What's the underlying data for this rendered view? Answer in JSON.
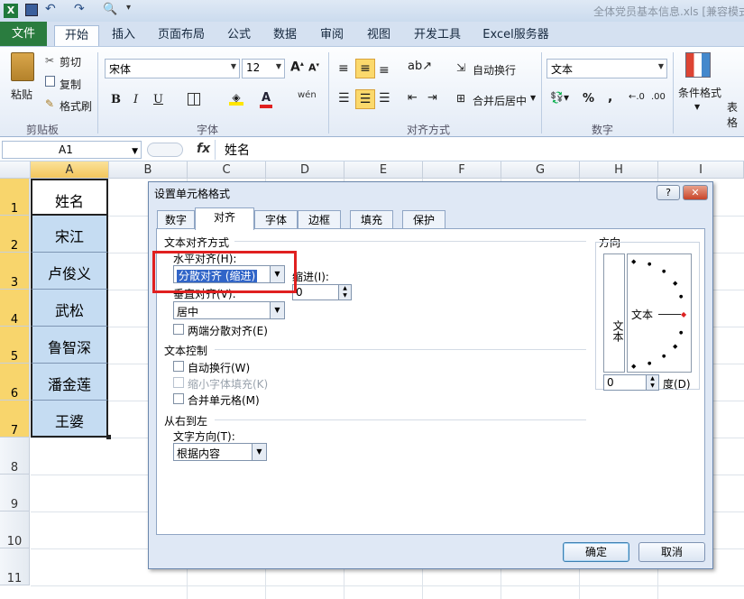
{
  "window": {
    "title": "全体党员基本信息.xls [兼容模式"
  },
  "ribbon_tabs": [
    "文件",
    "开始",
    "插入",
    "页面布局",
    "公式",
    "数据",
    "审阅",
    "视图",
    "开发工具",
    "Excel服务器"
  ],
  "clipboard": {
    "paste": "粘贴",
    "cut": "剪切",
    "copy": "复制",
    "format_painter": "格式刷",
    "group": "剪贴板"
  },
  "font": {
    "name": "宋体",
    "size": "12",
    "bold": "B",
    "italic": "I",
    "underline": "U",
    "group": "字体"
  },
  "alignment": {
    "wrap": "自动换行",
    "merge": "合并后居中",
    "group": "对齐方式"
  },
  "number": {
    "format": "文本",
    "percent": "%",
    "comma": ",",
    "group": "数字"
  },
  "styles": {
    "conditional": "条件格式",
    "table": "表格"
  },
  "formula_bar": {
    "cell_ref": "A1",
    "fx": "fx",
    "value": "姓名"
  },
  "columns": [
    "A",
    "B",
    "C",
    "D",
    "E",
    "F",
    "G",
    "H",
    "I"
  ],
  "rows": [
    "1",
    "2",
    "3",
    "4",
    "5",
    "6",
    "7",
    "8",
    "9",
    "10",
    "11"
  ],
  "cells": [
    "姓名",
    "宋江",
    "卢俊义",
    "武松",
    "鲁智深",
    "潘金莲",
    "王婆"
  ],
  "dialog": {
    "title": "设置单元格格式",
    "help": "?",
    "close": "✕",
    "tabs": [
      "数字",
      "对齐",
      "字体",
      "边框",
      "填充",
      "保护"
    ],
    "text_align_section": "文本对齐方式",
    "horizontal_label": "水平对齐(H):",
    "horizontal_value": "分散对齐 (缩进)",
    "indent_label": "缩进(I):",
    "indent_value": "0",
    "vertical_label": "垂直对齐(V):",
    "vertical_value": "居中",
    "justify_distributed": "两端分散对齐(E)",
    "text_control_section": "文本控制",
    "wrap_text": "自动换行(W)",
    "shrink_to_fit": "缩小字体填充(K)",
    "merge_cells": "合并单元格(M)",
    "rtl_section": "从右到左",
    "text_direction_label": "文字方向(T):",
    "text_direction_value": "根据内容",
    "orientation_section": "方向",
    "orientation_vertical_text": "文本",
    "orientation_text": "文本",
    "degrees_value": "0",
    "degrees_label": "度(D)",
    "ok": "确定",
    "cancel": "取消"
  },
  "colors": {
    "highlight": "#e02020",
    "file_tab": "#2a7c3f",
    "selection": "#c5dcf2",
    "row_selected": "#f8d56c"
  }
}
